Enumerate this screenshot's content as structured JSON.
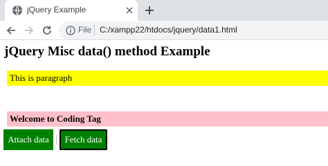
{
  "browser": {
    "tab": {
      "title": "jQuery Example",
      "favicon": "globe-icon"
    },
    "new_tab_icon": "plus-icon",
    "address_bar": {
      "security_icon": "info-icon",
      "scheme_label": "File",
      "url": "C:/xampp22/htdocs/jquery/data1.html"
    },
    "nav": [
      "back-arrow-icon",
      "forward-arrow-icon",
      "reload-icon"
    ]
  },
  "page": {
    "title": "jQuery Misc data() method Example",
    "paragraph": "This is paragraph",
    "heading": "Welcome to Coding Tag",
    "buttons": {
      "attach": "Attach data",
      "fetch": "Fetch data"
    }
  },
  "colors": {
    "paragraph_bg": "#ffff00",
    "heading_bg": "#ffc0cb",
    "button_bg": "#008000",
    "button_text": "#ffffff",
    "tabstrip_bg": "#dee1e6",
    "omnibox_bg": "#f1f3f4"
  }
}
